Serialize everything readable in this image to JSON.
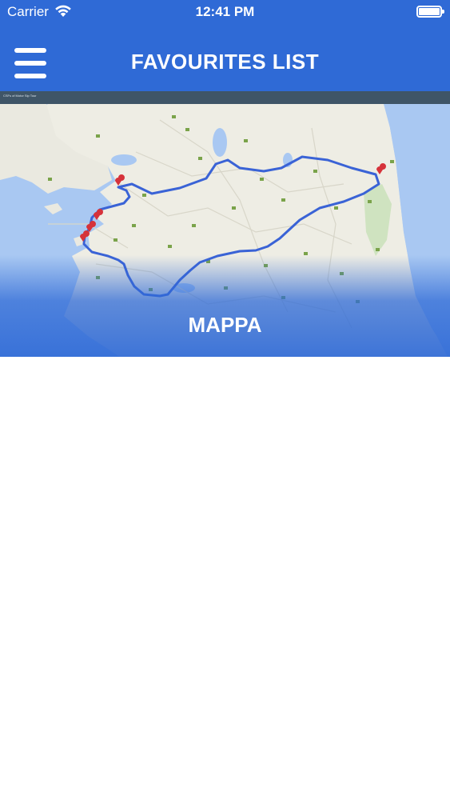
{
  "status_bar": {
    "carrier": "Carrier",
    "time": "12:41 PM"
  },
  "header": {
    "title": "FAVOURITES LIST",
    "menu_icon": "hamburger-menu-icon",
    "background_color": "#2f6ad6"
  },
  "card": {
    "label": "MAPPA",
    "map_caption": "CSFs of Motor Sip Tour",
    "route_color": "#3a63d6",
    "marker_color": "#d6323a"
  }
}
